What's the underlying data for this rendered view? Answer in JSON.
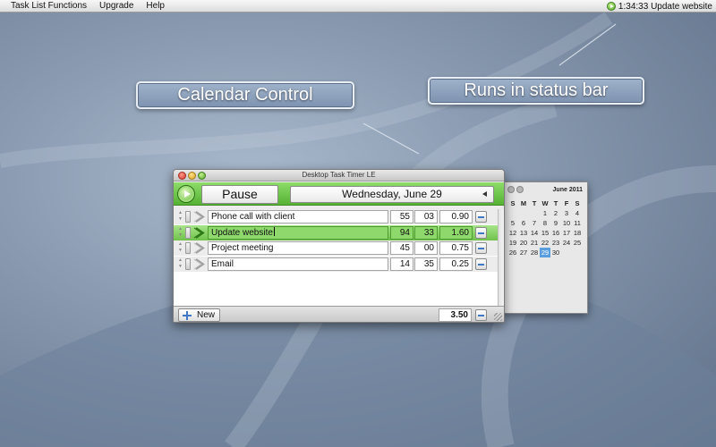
{
  "menubar": {
    "items": [
      "Task List Functions",
      "Upgrade",
      "Help"
    ],
    "status_text": "1:34:33 Update website"
  },
  "callouts": {
    "calendar": "Calendar Control",
    "status_bar": "Runs in status bar"
  },
  "window": {
    "title": "Desktop Task Timer LE",
    "pause_label": "Pause",
    "date_label": "Wednesday, June 29"
  },
  "tasks": [
    {
      "name": "Phone call with client",
      "minutes": "55",
      "seconds": "03",
      "value": "0.90",
      "active": false
    },
    {
      "name": "Update website",
      "minutes": "94",
      "seconds": "33",
      "value": "1.60",
      "active": true
    },
    {
      "name": "Project meeting",
      "minutes": "45",
      "seconds": "00",
      "value": "0.75",
      "active": false
    },
    {
      "name": "Email",
      "minutes": "14",
      "seconds": "35",
      "value": "0.25",
      "active": false
    }
  ],
  "footer": {
    "new_label": "New",
    "total": "3.50"
  },
  "calendar": {
    "month_label": "June 2011",
    "weekdays": [
      "S",
      "M",
      "T",
      "W",
      "T",
      "F",
      "S"
    ],
    "weeks": [
      [
        "",
        "",
        "",
        "1",
        "2",
        "3",
        "4"
      ],
      [
        "5",
        "6",
        "7",
        "8",
        "9",
        "10",
        "11"
      ],
      [
        "12",
        "13",
        "14",
        "15",
        "16",
        "17",
        "18"
      ],
      [
        "19",
        "20",
        "21",
        "22",
        "23",
        "24",
        "25"
      ],
      [
        "26",
        "27",
        "28",
        "29",
        "30",
        "",
        ""
      ]
    ],
    "selected_day": "29"
  },
  "colors": {
    "accent_green": "#6fc24b",
    "selection_blue": "#5b9ee0",
    "callout_fill": "#8aa0bd"
  }
}
